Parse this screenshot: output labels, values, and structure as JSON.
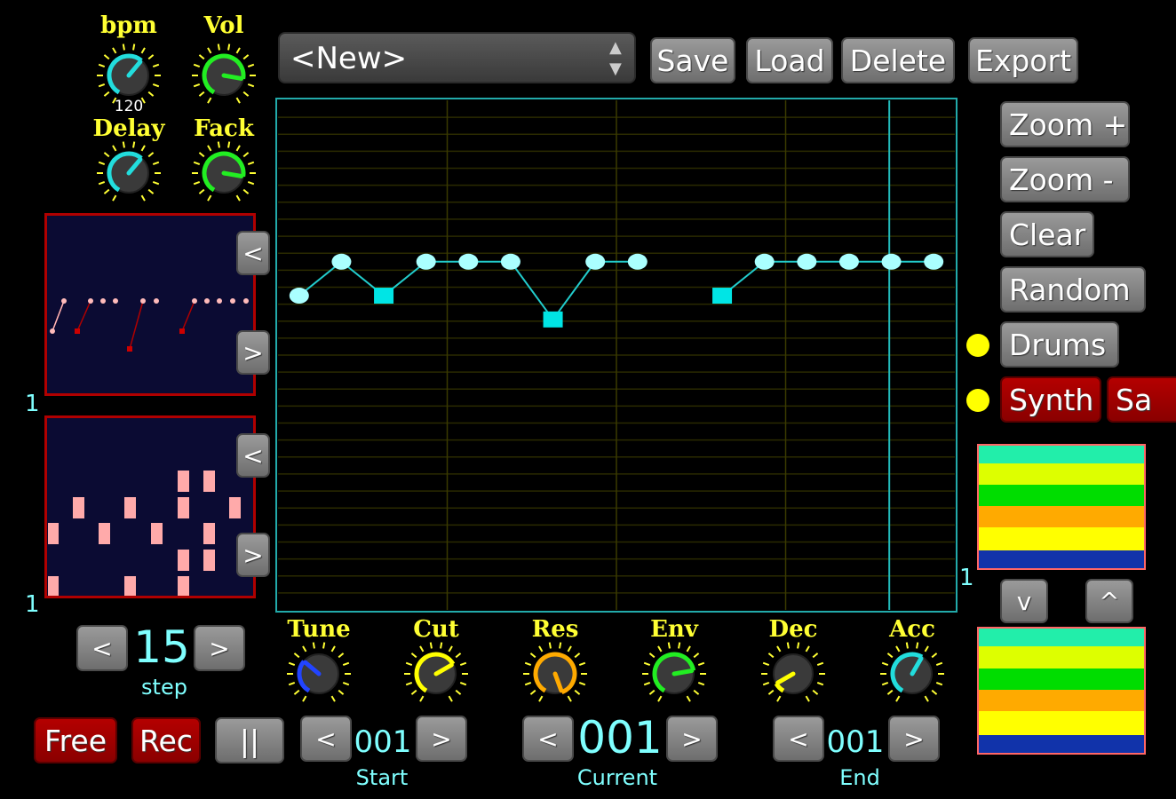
{
  "knobs_top": [
    {
      "label": "bpm",
      "value_text": "120",
      "color": "#22dddd",
      "angle": 40
    },
    {
      "label": "Vol",
      "value_text": "",
      "color": "#22ee22",
      "angle": 100
    },
    {
      "label": "Delay",
      "value_text": "",
      "color": "#22dddd",
      "angle": 40
    },
    {
      "label": "Fack",
      "value_text": "",
      "color": "#22ee22",
      "angle": 100
    }
  ],
  "preset": {
    "name": "<New>",
    "arrows": "▲▼"
  },
  "toolbar": {
    "save": "Save",
    "load": "Load",
    "delete": "Delete",
    "export": "Export"
  },
  "side_buttons": {
    "zoom_in": "Zoom +",
    "zoom_out": "Zoom -",
    "clear": "Clear",
    "random": "Random",
    "drums": "Drums",
    "synth": "Synth",
    "sample": "Sa"
  },
  "nav": {
    "left": "<",
    "right": ">",
    "up": "^",
    "down": "v"
  },
  "channel_labels": {
    "upper": "1",
    "lower": "1",
    "grid": "1"
  },
  "step": {
    "value": "15",
    "label": "step"
  },
  "synth_knobs": [
    {
      "label": "Tune",
      "color": "#2244ff",
      "angle": -50
    },
    {
      "label": "Cut",
      "color": "#ffff00",
      "angle": 60
    },
    {
      "label": "Res",
      "color": "#ffaa00",
      "angle": 160
    },
    {
      "label": "Env",
      "color": "#22ee22",
      "angle": 80
    },
    {
      "label": "Dec",
      "color": "#ffff00",
      "angle": -120
    },
    {
      "label": "Acc",
      "color": "#22dddd",
      "angle": 30
    }
  ],
  "transport": {
    "free": "Free",
    "rec": "Rec",
    "pause": "||",
    "start_value": "001",
    "start_label": "Start",
    "current_value": "001",
    "current_label": "Current",
    "end_value": "001",
    "end_label": "End"
  },
  "sequence": [
    {
      "step": 0,
      "note": 1,
      "shape": "circle"
    },
    {
      "step": 1,
      "note": 0,
      "shape": "circle"
    },
    {
      "step": 2,
      "note": 1,
      "shape": "square"
    },
    {
      "step": 3,
      "note": 0,
      "shape": "circle"
    },
    {
      "step": 4,
      "note": 0,
      "shape": "circle"
    },
    {
      "step": 5,
      "note": 0,
      "shape": "circle"
    },
    {
      "step": 6,
      "note": 2,
      "shape": "square"
    },
    {
      "step": 7,
      "note": 0,
      "shape": "circle"
    },
    {
      "step": 8,
      "note": 0,
      "shape": "circle"
    },
    {
      "step": 10,
      "note": 1,
      "shape": "square"
    },
    {
      "step": 11,
      "note": 0,
      "shape": "circle"
    },
    {
      "step": 12,
      "note": 0,
      "shape": "circle"
    },
    {
      "step": 13,
      "note": 0,
      "shape": "circle"
    },
    {
      "step": 14,
      "note": 0,
      "shape": "circle"
    },
    {
      "step": 15,
      "note": 0,
      "shape": "circle"
    }
  ],
  "playhead_step": 14,
  "colors": {
    "accent": "#22dddd",
    "yellow": "#ffff00",
    "red_button": "#b40000",
    "panel_border": "#b00000"
  },
  "meter_bands": [
    "#22eeaa",
    "#ddff00",
    "#00dd00",
    "#ffaa00",
    "#ffff00",
    "#1133aa"
  ]
}
